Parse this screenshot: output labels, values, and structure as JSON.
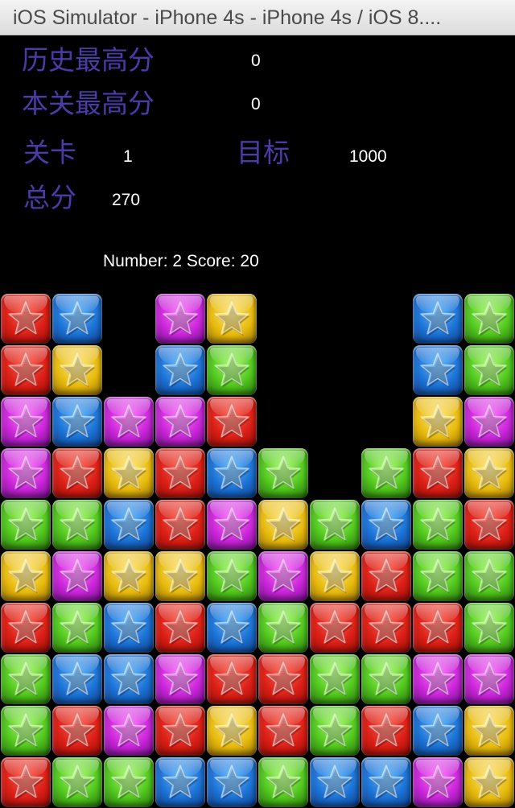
{
  "window": {
    "title": "iOS Simulator - iPhone 4s - iPhone 4s / iOS 8...."
  },
  "hud": {
    "best_label": "历史最高分",
    "best_value": "0",
    "level_best_label": "本关最高分",
    "level_best_value": "0",
    "level_label": "关卡",
    "level_value": "1",
    "target_label": "目标",
    "target_value": "1000",
    "total_label": "总分",
    "total_value": "270"
  },
  "status": {
    "text": "Number: 2 Score: 20"
  },
  "colors": {
    "hud_label": "#4b3aa8",
    "background": "#000000",
    "red": "#d81d14",
    "blue": "#1a6fd2",
    "purple": "#c724d6",
    "yellow": "#e6b80b",
    "green": "#4ec31b"
  },
  "board": {
    "cols": 10,
    "rows": 10,
    "icon": "star-icon",
    "cells": [
      [
        "R",
        "B",
        ".",
        "P",
        "Y",
        ".",
        ".",
        ".",
        "B",
        "G"
      ],
      [
        "R",
        "Y",
        ".",
        "B",
        "G",
        ".",
        ".",
        ".",
        "B",
        "G"
      ],
      [
        "P",
        "B",
        "P",
        "P",
        "R",
        ".",
        ".",
        ".",
        "Y",
        "P"
      ],
      [
        "P",
        "R",
        "Y",
        "R",
        "B",
        "G",
        ".",
        "G",
        "R",
        "Y"
      ],
      [
        "G",
        "G",
        "B",
        "R",
        "P",
        "Y",
        "G",
        "B",
        "G",
        "R"
      ],
      [
        "Y",
        "P",
        "Y",
        "Y",
        "G",
        "P",
        "Y",
        "R",
        "G",
        "G"
      ],
      [
        "R",
        "G",
        "B",
        "R",
        "B",
        "G",
        "R",
        "R",
        "R",
        "G"
      ],
      [
        "G",
        "B",
        "B",
        "P",
        "R",
        "R",
        "G",
        "G",
        "P",
        "P"
      ],
      [
        "G",
        "R",
        "P",
        "R",
        "Y",
        "R",
        "G",
        "R",
        "B",
        "Y"
      ],
      [
        "R",
        "G",
        "G",
        "B",
        "B",
        "G",
        "B",
        "B",
        "P",
        "Y"
      ]
    ]
  }
}
